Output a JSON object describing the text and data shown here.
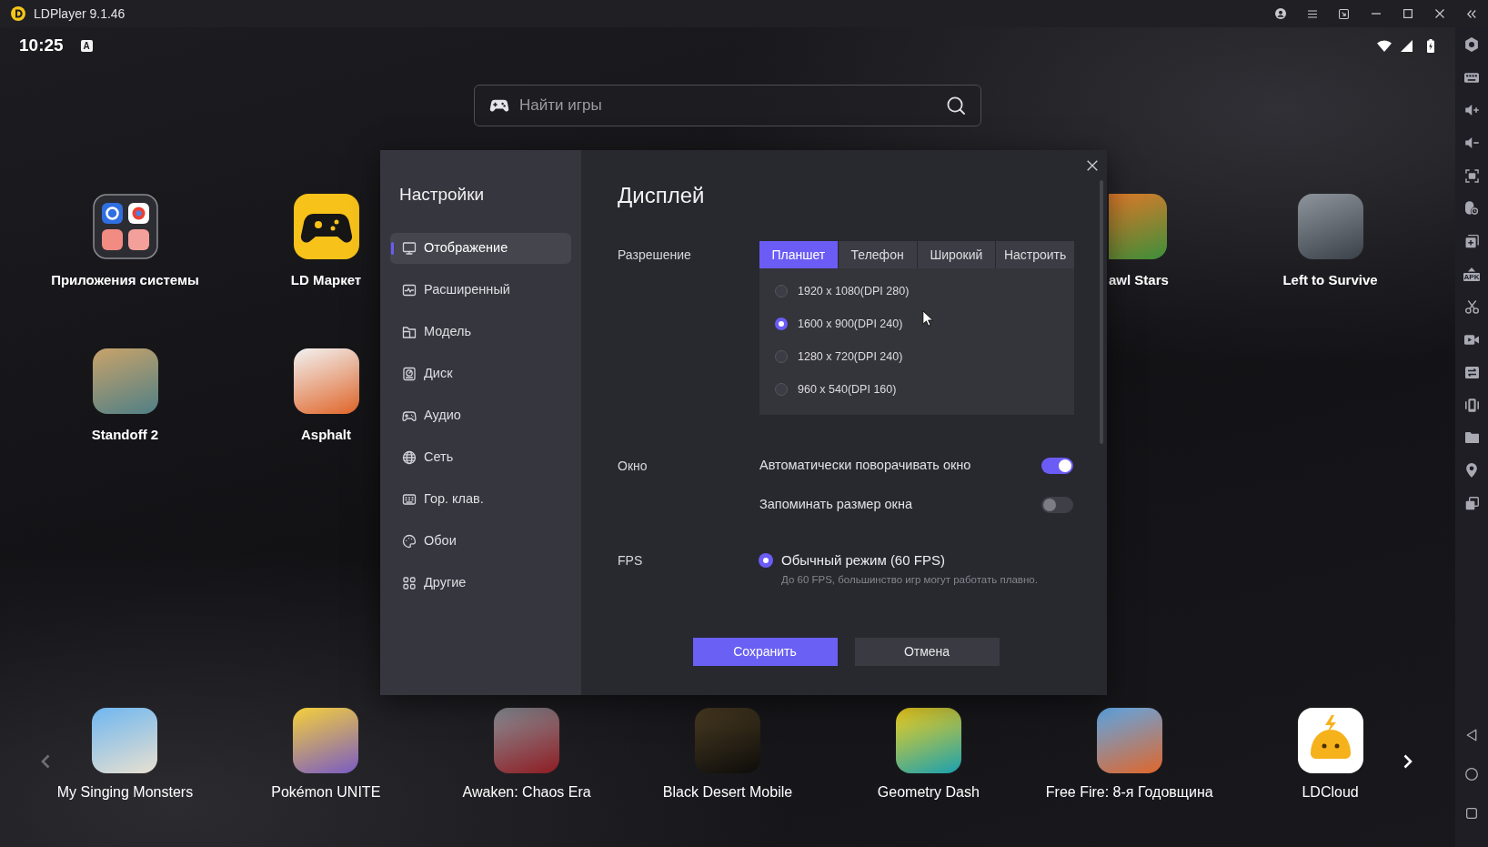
{
  "title_bar": {
    "title": "LDPlayer 9.1.46",
    "controls": [
      {
        "kind": "account"
      },
      {
        "kind": "menu"
      },
      {
        "kind": "popout"
      },
      {
        "kind": "minimize"
      },
      {
        "kind": "maximize"
      },
      {
        "kind": "close"
      },
      {
        "kind": "collapse"
      }
    ]
  },
  "status_bar": {
    "time": "10:25",
    "notification": "A"
  },
  "search": {
    "placeholder": "Найти игры"
  },
  "desktop": {
    "rows": [
      {
        "left": [
          {
            "kind": "folder",
            "label": "Приложения системы"
          },
          {
            "kind": "gamepad",
            "label": "LD Маркет"
          }
        ],
        "right": [
          {
            "kind": "covered",
            "label": "awl Stars"
          },
          {
            "kind": "photo",
            "label": "Left to Survive"
          }
        ]
      },
      {
        "left": [
          {
            "kind": "photo",
            "label": "Standoff 2"
          },
          {
            "kind": "photo",
            "label": "Asphalt"
          }
        ]
      }
    ]
  },
  "settings_dialog": {
    "sidebar": {
      "title": "Настройки",
      "items": [
        {
          "kind": "display",
          "label": "Отображение",
          "selected": true
        },
        {
          "kind": "advanced",
          "label": "Расширенный",
          "selected": false
        },
        {
          "kind": "model",
          "label": "Модель",
          "selected": false
        },
        {
          "kind": "disk",
          "label": "Диск",
          "selected": false
        },
        {
          "kind": "audio",
          "label": "Аудио",
          "selected": false
        },
        {
          "kind": "network",
          "label": "Сеть",
          "selected": false
        },
        {
          "kind": "keyboard",
          "label": "Гор. клав.",
          "selected": false
        },
        {
          "kind": "wallpaper",
          "label": "Обои",
          "selected": false
        },
        {
          "kind": "other",
          "label": "Другие",
          "selected": false
        }
      ]
    },
    "title": "Дисплей",
    "resolution": {
      "label": "Разрешение",
      "tabs": [
        {
          "label": "Планшет",
          "selected": true
        },
        {
          "label": "Телефон",
          "selected": false
        },
        {
          "label": "Широкий",
          "selected": false
        },
        {
          "label": "Настроить",
          "selected": false
        }
      ],
      "options": [
        {
          "label": "1920 x 1080(DPI 280)",
          "selected": false
        },
        {
          "label": "1600 x 900(DPI 240)",
          "selected": true
        },
        {
          "label": "1280 x 720(DPI 240)",
          "selected": false
        },
        {
          "label": "960 x 540(DPI 160)",
          "selected": false
        }
      ]
    },
    "window": {
      "label": "Окно",
      "switches": [
        {
          "label": "Автоматически поворачивать окно",
          "on": true
        },
        {
          "label": "Запоминать размер окна",
          "on": false
        }
      ]
    },
    "fps": {
      "label": "FPS",
      "options": [
        {
          "label": "Обычный режим (60 FPS)",
          "hint": "До 60 FPS, большинство игр могут работать плавно.",
          "selected": true
        }
      ]
    },
    "buttons": [
      {
        "kind": "primary",
        "label": "Сохранить"
      },
      {
        "kind": "secondary",
        "label": "Отмена"
      }
    ]
  },
  "dock": {
    "apps": [
      {
        "kind": "photo",
        "label": "My Singing Monsters"
      },
      {
        "kind": "photo",
        "label": "Pokémon UNITE"
      },
      {
        "kind": "photo",
        "label": "Awaken: Chaos Era"
      },
      {
        "kind": "photo",
        "label": "Black Desert Mobile"
      },
      {
        "kind": "photo",
        "label": "Geometry Dash"
      },
      {
        "kind": "photo",
        "label": "Free Fire: 8-я Годовщина"
      },
      {
        "kind": "blob",
        "label": "LDCloud"
      }
    ]
  },
  "toolbar": {
    "tools": [
      {
        "kind": "settings"
      },
      {
        "kind": "keyboard"
      },
      {
        "kind": "volume-up"
      },
      {
        "kind": "volume-down"
      },
      {
        "kind": "fullscreen"
      },
      {
        "kind": "mouse"
      },
      {
        "kind": "add-window"
      },
      {
        "kind": "apk",
        "label": "APK"
      },
      {
        "kind": "scissors"
      },
      {
        "kind": "record"
      },
      {
        "kind": "sync"
      },
      {
        "kind": "shake"
      },
      {
        "kind": "folder"
      },
      {
        "kind": "location"
      },
      {
        "kind": "multi-window"
      }
    ],
    "navigation": [
      {
        "kind": "back"
      },
      {
        "kind": "home"
      },
      {
        "kind": "recent"
      }
    ]
  }
}
